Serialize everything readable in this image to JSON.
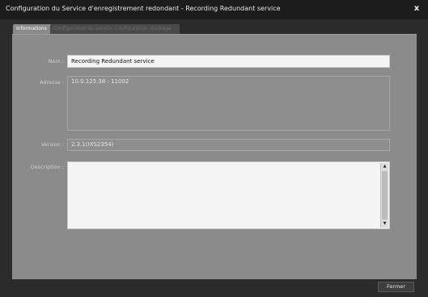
{
  "window": {
    "title": "Configuration du Service d'enregistrement redondant - Recording Redundant service",
    "close_glyph": "x"
  },
  "tabs": [
    {
      "label": "Informations",
      "active": true
    },
    {
      "label": "Configuration du service",
      "active": false
    },
    {
      "label": "Configuration stockage",
      "active": false
    }
  ],
  "form": {
    "nom_label": "Nom :",
    "nom_value": "Recording Redundant service",
    "adresse_label": "Adresse :",
    "adresse_value": "10.0.125.38 : 11002",
    "version_label": "Version :",
    "version_value": "2.3.1(IXS2354)",
    "description_label": "Description :",
    "description_value": ""
  },
  "scrollbar": {
    "up_glyph": "▲",
    "down_glyph": "▼"
  },
  "footer": {
    "close_label": "Fermer"
  },
  "colors": {
    "titlebar": "#1c1c1c",
    "panel": "#8b8b8b",
    "input_bg": "#f4f4f4",
    "readonly_bg": "#8e8e8e"
  }
}
